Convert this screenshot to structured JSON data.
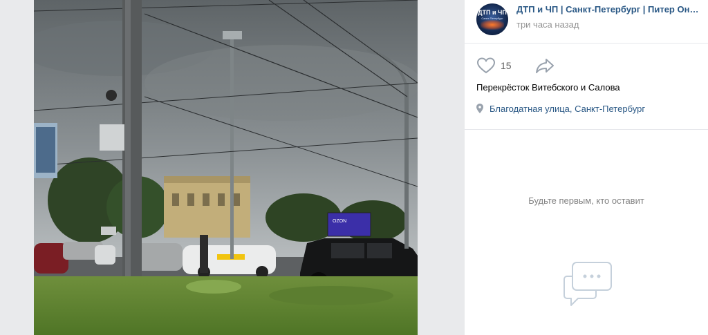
{
  "post": {
    "group_name": "ДТП и ЧП | Санкт-Петербург | Питер Онлайн",
    "time": "три часа назад",
    "avatar_text": "ДТП и ЧП",
    "avatar_sub": "Санкт-Петербург",
    "likes": "15",
    "text": "Перекрёсток Витебского и Салова",
    "location": "Благодатная улица, Санкт-Петербург"
  },
  "comments": {
    "empty_text": "Будьте первым, кто оставит"
  },
  "photo": {
    "billboard_text": "OZON"
  },
  "colors": {
    "link": "#2a5885",
    "muted": "#939393",
    "icon": "#99a2ad",
    "background": "#edeef0"
  },
  "icons": [
    "heart-icon",
    "share-arrow-icon",
    "location-pin-icon",
    "empty-comments-icon"
  ]
}
